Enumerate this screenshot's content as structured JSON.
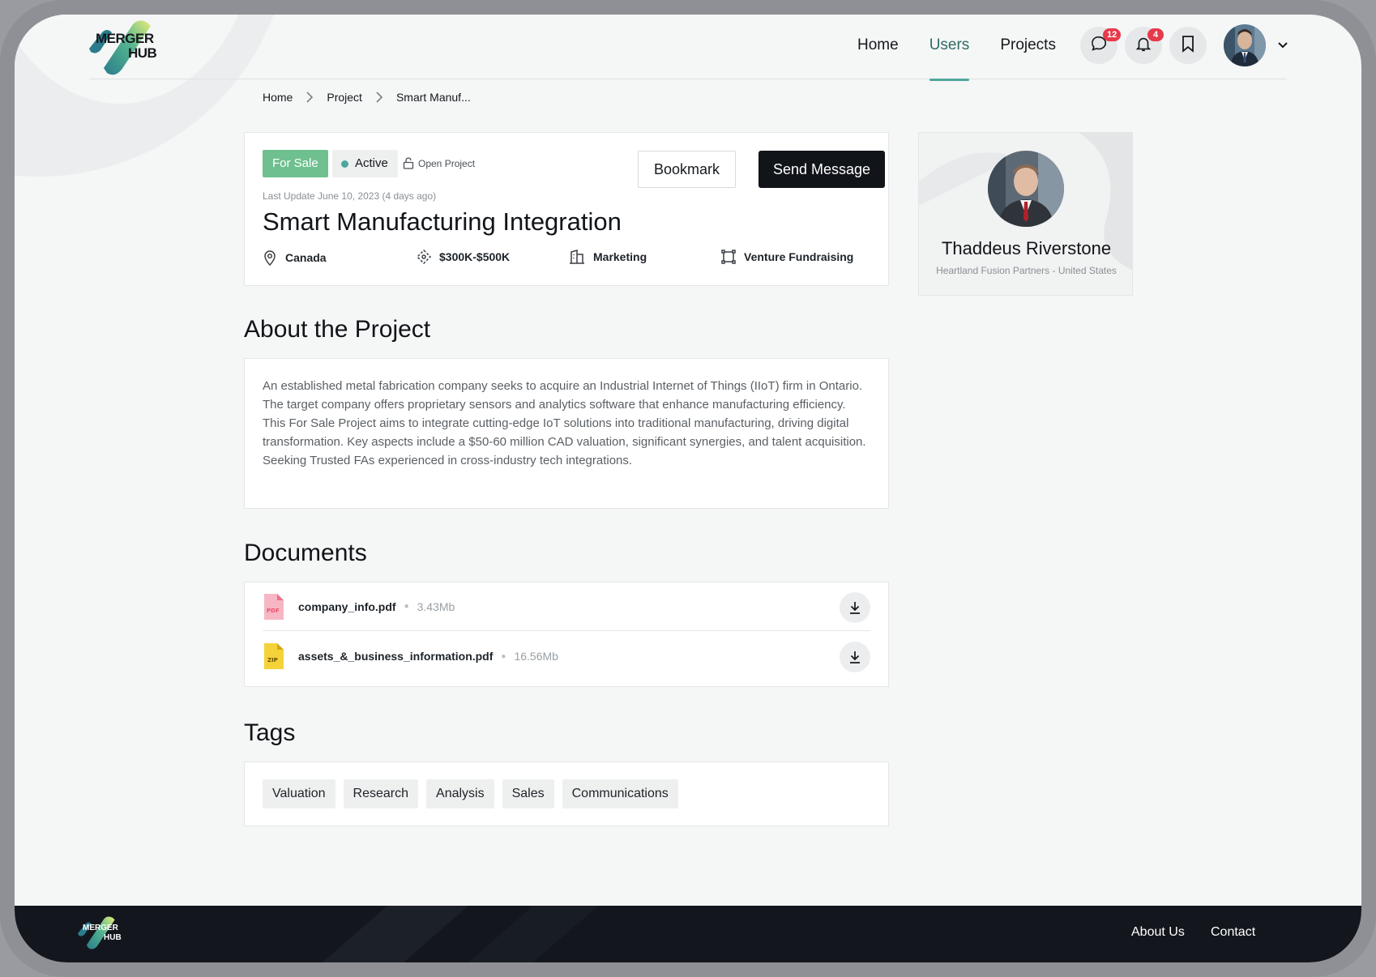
{
  "header": {
    "logo_text_1": "MERGER",
    "logo_text_2": "HUB",
    "nav": [
      {
        "label": "Home"
      },
      {
        "label": "Users"
      },
      {
        "label": "Projects"
      }
    ],
    "messages_count": "12",
    "notifications_count": "4"
  },
  "breadcrumb": [
    "Home",
    "Project",
    "Smart Manuf..."
  ],
  "project": {
    "status_sale": "For Sale",
    "status_active": "Active",
    "visibility": "Open Project",
    "bookmark_label": "Bookmark",
    "send_message_label": "Send Message",
    "last_update": "Last Update June 10, 2023 (4 days ago)",
    "title": "Smart Manufacturing Integration",
    "location": "Canada",
    "budget": "$300K-$500K",
    "industry": "Marketing",
    "type": "Venture Fundraising"
  },
  "about": {
    "heading": "About the Project",
    "paragraph_1": "An established metal fabrication company seeks to acquire an Industrial Internet of Things (IIoT) firm in Ontario. The target company offers proprietary sensors and analytics software that enhance manufacturing efficiency.",
    "paragraph_2": "This For Sale Project aims to integrate cutting-edge IoT solutions into traditional manufacturing, driving digital transformation. Key aspects include a $50-60 million CAD valuation, significant synergies, and talent acquisition. Seeking Trusted FAs experienced in cross-industry tech integrations."
  },
  "documents": {
    "heading": "Documents",
    "items": [
      {
        "name": "company_info.pdf",
        "size": "3.43Mb",
        "type": "PDF"
      },
      {
        "name": "assets_&_business_information.pdf",
        "size": "16.56Mb",
        "type": "ZIP"
      }
    ]
  },
  "tags": {
    "heading": "Tags",
    "items": [
      "Valuation",
      "Research",
      "Analysis",
      "Sales",
      "Communications"
    ]
  },
  "owner": {
    "name": "Thaddeus Riverstone",
    "subtitle": "Heartland Fusion Partners - United States"
  },
  "footer": {
    "logo_text_1": "MERGER",
    "logo_text_2": "HUB",
    "about_label": "About Us",
    "contact_label": "Contact"
  },
  "colors": {
    "accent": "#4ea69b",
    "sale_green": "#6fc08f",
    "badge_red": "#e63a4b",
    "dark": "#111418"
  }
}
